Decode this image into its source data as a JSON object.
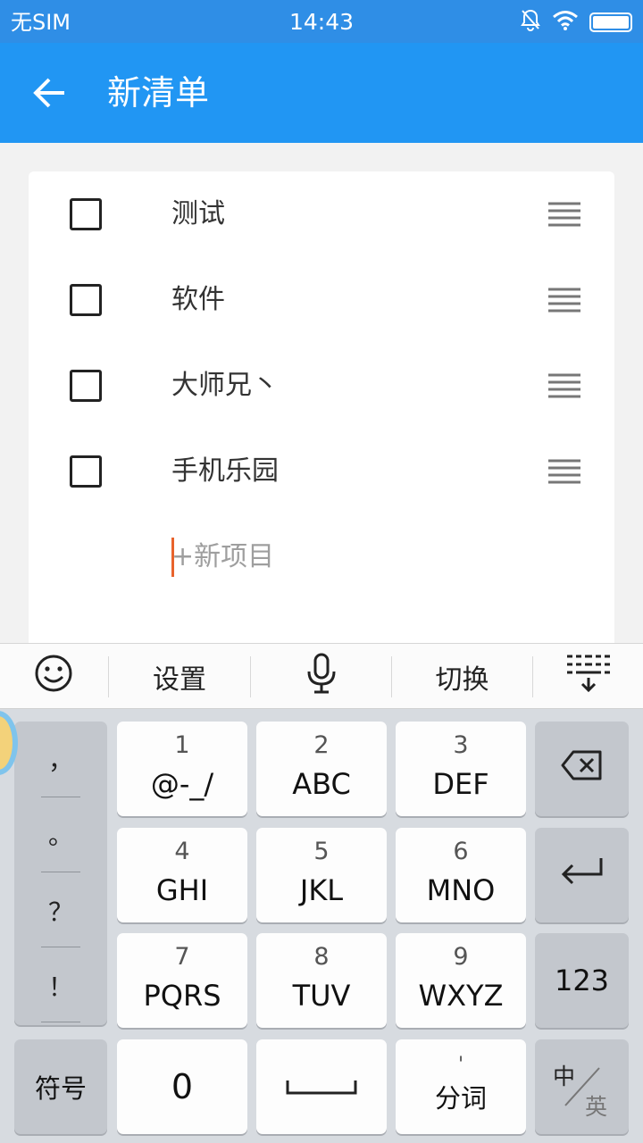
{
  "status_bar": {
    "carrier": "无SIM",
    "time": "14:43"
  },
  "app_bar": {
    "title": "新清单"
  },
  "checklist": {
    "items": [
      {
        "label": "测试",
        "checked": false
      },
      {
        "label": "软件",
        "checked": false
      },
      {
        "label": "大师兄丶",
        "checked": false
      },
      {
        "label": "手机乐园",
        "checked": false
      }
    ],
    "new_item_placeholder": "+新项目"
  },
  "keyboard_toolbar": {
    "settings": "设置",
    "switch": "切换"
  },
  "keyboard": {
    "punctuation": [
      "，",
      "。",
      "？",
      "！"
    ],
    "keys": [
      {
        "num": "1",
        "letters": "@-_/"
      },
      {
        "num": "2",
        "letters": "ABC"
      },
      {
        "num": "3",
        "letters": "DEF"
      },
      {
        "num": "4",
        "letters": "GHI"
      },
      {
        "num": "5",
        "letters": "JKL"
      },
      {
        "num": "6",
        "letters": "MNO"
      },
      {
        "num": "7",
        "letters": "PQRS"
      },
      {
        "num": "8",
        "letters": "TUV"
      },
      {
        "num": "9",
        "letters": "WXYZ"
      }
    ],
    "numeric_switch": "123",
    "symbols": "符号",
    "zero": "0",
    "segment_mark": "'",
    "segment_label": "分词",
    "lang_primary": "中",
    "lang_secondary": "英"
  },
  "colors": {
    "app_bar": "#2196f3",
    "status_bar": "#2f8ee6",
    "caret": "#e8632c"
  }
}
